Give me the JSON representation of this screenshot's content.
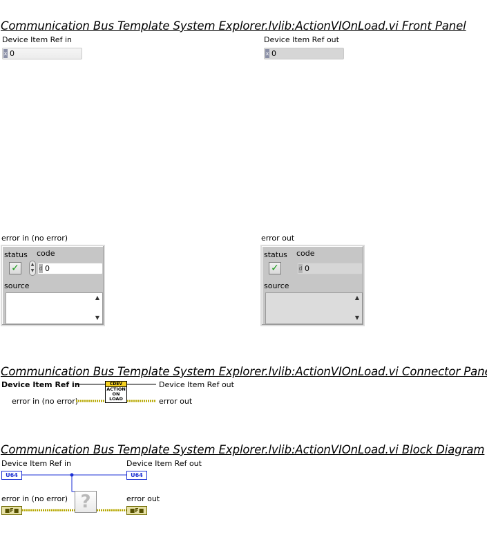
{
  "front_panel": {
    "title": "Communication Bus Template System Explorer.lvlib:ActionVIOnLoad.vi Front Panel",
    "device_in": {
      "label": "Device Item Ref in",
      "radix": "x",
      "value": "0"
    },
    "device_out": {
      "label": "Device Item Ref out",
      "radix": "x",
      "value": "0"
    },
    "error_in": {
      "label": "error in (no error)",
      "status_label": "status",
      "code_label": "code",
      "code_value": "0",
      "radix": "d",
      "source_label": "source",
      "status_glyph": "✓"
    },
    "error_out": {
      "label": "error out",
      "status_label": "status",
      "code_label": "code",
      "code_value": "0",
      "radix": "d",
      "source_label": "source",
      "status_glyph": "✓"
    }
  },
  "connector_pane": {
    "title": "Communication Bus Template System Explorer.lvlib:ActionVIOnLoad.vi Connector Pane",
    "in_top": "Device Item Ref in",
    "in_bottom": "error in (no error)",
    "out_top": "Device Item Ref out",
    "out_bottom": "error out",
    "icon_header": "CDEV",
    "icon_lines": [
      "ACTION",
      "ON",
      "LOAD"
    ]
  },
  "block_diagram": {
    "title": "Communication Bus Template System Explorer.lvlib:ActionVIOnLoad.vi Block Diagram",
    "device_in_label": "Device Item Ref in",
    "device_out_label": "Device Item Ref out",
    "error_in_label": "error in (no error)",
    "error_out_label": "error out",
    "u64_text": "U64",
    "err_text": "■F■",
    "unknown_glyph": "?"
  },
  "colors": {
    "ref_wire": "#1b2fd4",
    "error_wire": "#b7a800"
  }
}
